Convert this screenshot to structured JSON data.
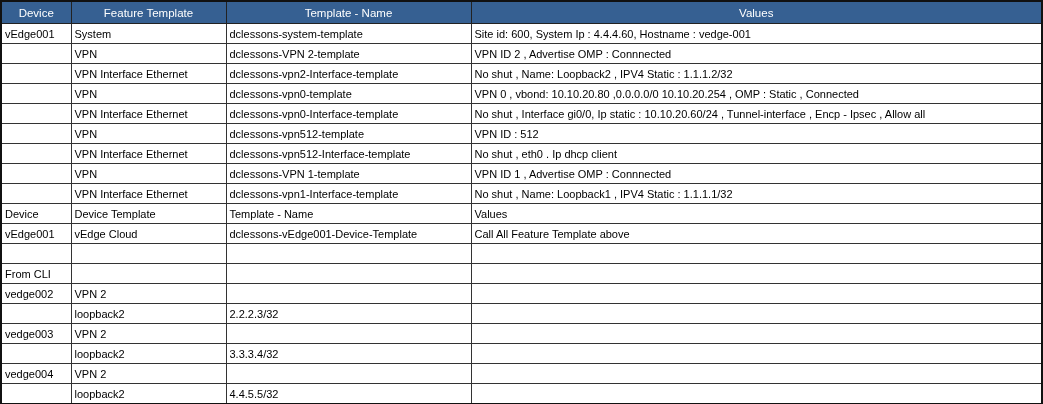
{
  "table": {
    "columns": [
      "Device",
      "Feature Template",
      "Template - Name",
      "Values"
    ],
    "rows": [
      [
        "vEdge001",
        "System",
        "dclessons-system-template",
        "Site id: 600, System Ip : 4.4.4.60, Hostname : vedge-001"
      ],
      [
        null,
        "VPN",
        "dclessons-VPN 2-template",
        "VPN ID 2 , Advertise OMP : Connnected"
      ],
      [
        null,
        "VPN Interface Ethernet",
        "dclessons-vpn2-Interface-template",
        "No shut , Name: Loopback2 , IPV4 Static : 1.1.1.2/32"
      ],
      [
        null,
        "VPN",
        "dclessons-vpn0-template",
        "VPN 0 , vbond: 10.10.20.80 ,0.0.0.0/0 10.10.20.254 , OMP : Static , Connected"
      ],
      [
        null,
        "VPN Interface Ethernet",
        "dclessons-vpn0-Interface-template",
        "No shut , Interface gi0/0, Ip static : 10.10.20.60/24 , Tunnel-interface , Encp - Ipsec , Allow all"
      ],
      [
        null,
        "VPN",
        "dclessons-vpn512-template",
        "VPN ID : 512"
      ],
      [
        null,
        "VPN Interface Ethernet",
        "dclessons-vpn512-Interface-template",
        "No shut , eth0 . Ip dhcp client"
      ],
      [
        null,
        "VPN",
        "dclessons-VPN 1-template",
        "VPN ID 1 , Advertise OMP : Connnected"
      ],
      [
        null,
        "VPN Interface Ethernet",
        "dclessons-vpn1-Interface-template",
        "No shut , Name: Loopback1 , IPV4 Static : 1.1.1.1/32"
      ],
      [
        "Device",
        "Device Template",
        "Template - Name",
        "Values"
      ],
      [
        "vEdge001",
        "vEdge Cloud",
        "dclessons-vEdge001-Device-Template",
        "Call All Feature Template above"
      ],
      [
        null,
        null,
        null,
        null
      ],
      [
        "From CLI",
        null,
        null,
        null
      ],
      [
        "vedge002",
        "VPN 2",
        null,
        null
      ],
      [
        null,
        "loopback2",
        "2.2.2.3/32",
        null
      ],
      [
        "vedge003",
        "VPN 2",
        null,
        null
      ],
      [
        null,
        "loopback2",
        "3.3.3.4/32",
        null
      ],
      [
        "vedge004",
        "VPN 2",
        null,
        null
      ],
      [
        null,
        "loopback2",
        "4.4.5.5/32",
        null
      ]
    ]
  }
}
